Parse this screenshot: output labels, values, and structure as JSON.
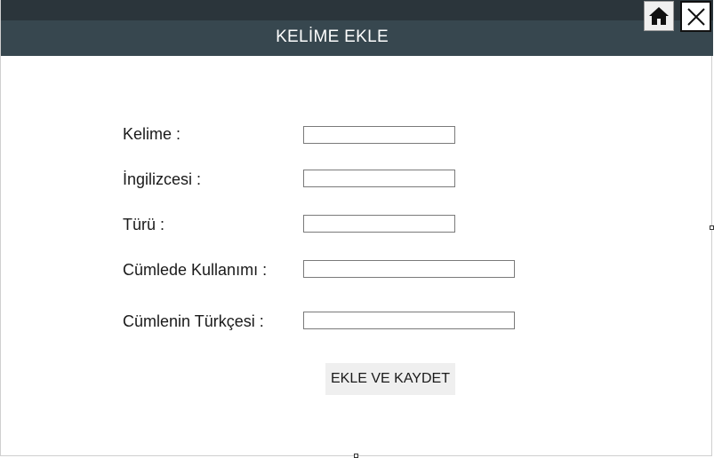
{
  "header": {
    "title": "KELİME EKLE"
  },
  "window_buttons": {
    "home_icon": "home-icon",
    "close_icon": "close-icon"
  },
  "form": {
    "word_label": "Kelime :",
    "word_value": "",
    "english_label": "İngilizcesi :",
    "english_value": "",
    "type_label": "Türü :",
    "type_value": "",
    "usage_label": "Cümlede Kullanımı :",
    "usage_value": "",
    "translation_label": "Cümlenin Türkçesi :",
    "translation_value": "",
    "submit_label": "EKLE VE KAYDET"
  },
  "colors": {
    "title_bar": "#37474f",
    "top_strip": "#2b353b",
    "button_bg": "#efefef"
  }
}
